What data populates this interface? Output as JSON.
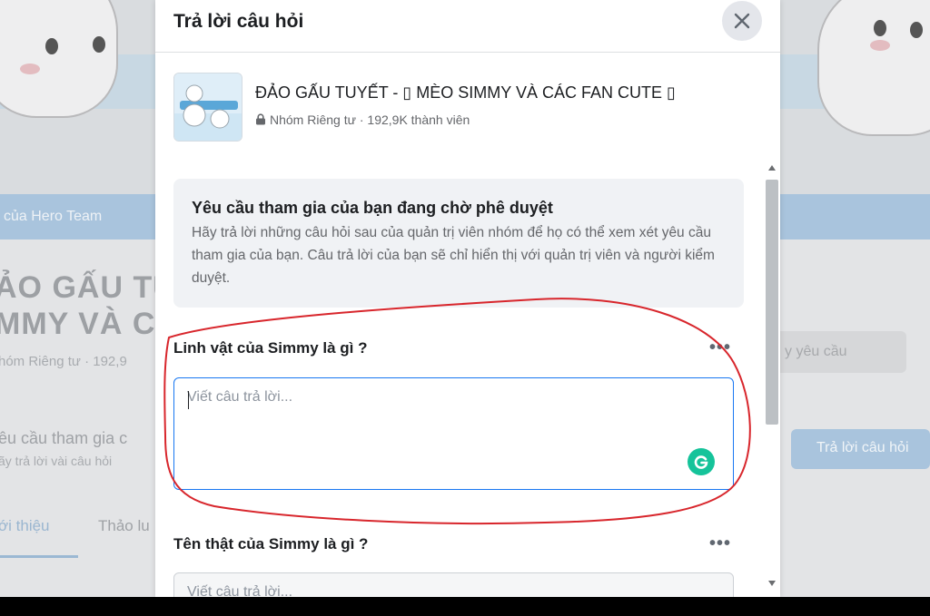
{
  "background": {
    "bar_text": "của Hero Team",
    "title_line1": "ẢO GẤU TU",
    "title_line2": "MMY VÀ C",
    "meta": "hóm Riêng tư · 192,9",
    "request_title": "êu cầu tham gia c",
    "request_sub": "ãy trả lời vài câu hỏi",
    "tab_about": "ới thiệu",
    "tab_discussion": "Thảo lu",
    "right_field": "y yêu cầu",
    "right_button": "Trả lời câu hỏi"
  },
  "modal": {
    "title": "Trả lời câu hỏi",
    "group": {
      "name": "ĐẢO GẤU TUYẾT - ▯ MÈO SIMMY VÀ CÁC FAN CUTE ▯",
      "meta": "Nhóm Riêng tư · 192,9K thành viên"
    },
    "notice": {
      "title": "Yêu cầu tham gia của bạn đang chờ phê duyệt",
      "body": "Hãy trả lời những câu hỏi sau của quản trị viên nhóm để họ có thể xem xét yêu cầu tham gia của bạn. Câu trả lời của bạn sẽ chỉ hiển thị với quản trị viên và người kiểm duyệt."
    },
    "questions": [
      {
        "label": "Linh vật của Simmy là gì ?",
        "more": "•••",
        "placeholder": "Viết câu trả lời..."
      },
      {
        "label": "Tên thật của Simmy là gì ?",
        "more": "•••",
        "placeholder": "Viết câu trả lời..."
      }
    ]
  },
  "colors": {
    "accent": "#1877f2",
    "grammarly": "#15c39a",
    "annotation": "#d8262c"
  }
}
